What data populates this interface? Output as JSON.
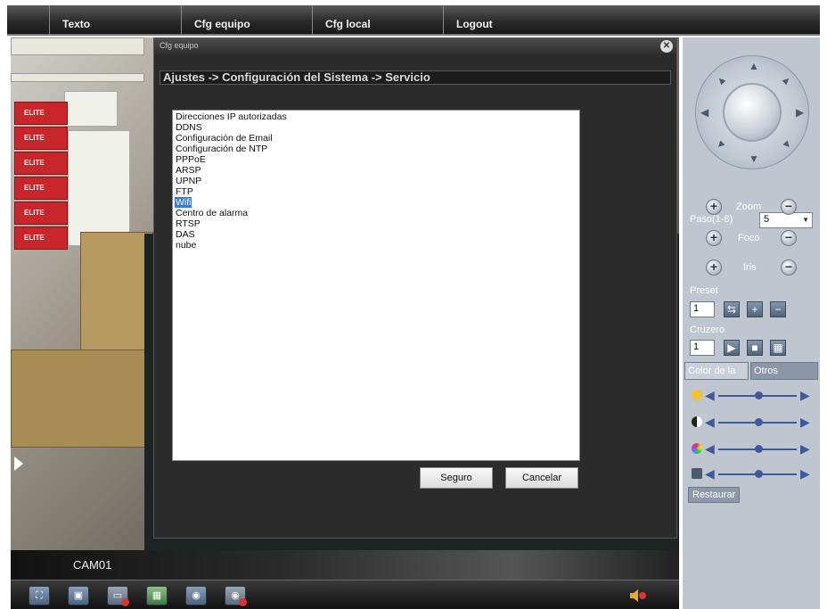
{
  "topbar": {
    "tabs": [
      "Texto",
      "Cfg equipo",
      "Cfg local",
      "Logout"
    ]
  },
  "video": {
    "camera_label": "CAM01",
    "box_labels": [
      "ELITE",
      "ELITE",
      "ELITE",
      "ELITE",
      "ELITE",
      "ELITE"
    ]
  },
  "dialog": {
    "title": "Cfg equipo",
    "breadcrumb": "Ajustes -> Configuración del Sistema -> Servicio",
    "items": [
      "Direcciones IP autorizadas",
      "DDNS",
      "Configuración de Email",
      "Configuración de NTP",
      "PPPoE",
      "ARSP",
      "UPNP",
      "FTP",
      "Wifi",
      "Centro de alarma",
      "RTSP",
      "DAS",
      "nube"
    ],
    "selected_item": "Wifi",
    "ok_label": "Seguro",
    "cancel_label": "Cancelar"
  },
  "panel": {
    "step_label": "Paso(1-8)",
    "step_value": "5",
    "zoom_label": "Zoom",
    "focus_label": "Foco",
    "iris_label": "Iris",
    "preset_label": "Preset",
    "preset_value": "1",
    "cruise_label": "Cruzero",
    "cruise_value": "1",
    "color_tabs": [
      "Color de la",
      "Otros"
    ],
    "restore_label": "Restaurar"
  },
  "icons": {
    "close": "close-icon",
    "speaker": "speaker-icon"
  },
  "colors": {
    "dialog_bg": "#2b2b2b",
    "panel_bg": "#bfc6d0",
    "selection": "#3a7bd5",
    "slider": "#3f5a9a"
  }
}
